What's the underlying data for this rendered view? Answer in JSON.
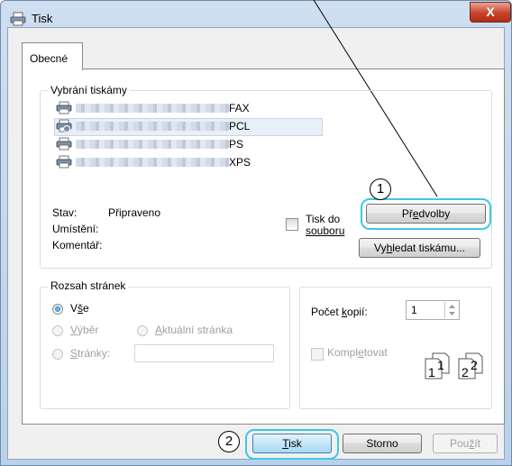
{
  "window": {
    "title": "Tisk",
    "close": "X"
  },
  "tabs": [
    {
      "label": "Obecné"
    }
  ],
  "printer_selection": {
    "title": "Vybrání tiskámy",
    "printers": [
      {
        "suffix": "FAX"
      },
      {
        "suffix": "PCL",
        "selected": true
      },
      {
        "suffix": "PS"
      },
      {
        "suffix": "XPS"
      }
    ],
    "status_label": "Stav:",
    "status_value": "Připraveno",
    "location_label": "Umístění:",
    "comment_label": "Komentář:",
    "print_to_file_line1": "Tisk do",
    "print_to_file_line2": "souboru",
    "preferences_button": {
      "pre": "Př",
      "accel": "e",
      "post": "dvolby"
    },
    "find_printer_button": {
      "pre": "Vy",
      "accel": "h",
      "post": "ledat tiskámu..."
    }
  },
  "page_range": {
    "title": "Rozsah stránek",
    "all": {
      "pre": "V",
      "accel": "š",
      "post": "e"
    },
    "selection": {
      "accel": "V",
      "post": "ýběr"
    },
    "current_page": {
      "accel": "A",
      "post": "ktuální stránka"
    },
    "pages": {
      "accel": "S",
      "post": "tránky:"
    }
  },
  "copies": {
    "label_pre": "Počet ",
    "label_accel": "k",
    "label_post": "opií:",
    "value": "1",
    "collate_pre": "Kompl",
    "collate_accel": "e",
    "collate_post": "tovat",
    "collate_icon_labels": [
      "1",
      "1",
      "2",
      "2"
    ]
  },
  "buttons": {
    "print": {
      "accel": "T",
      "post": "isk"
    },
    "cancel": "Storno",
    "apply": {
      "pre": "Pou",
      "accel": "ž",
      "post": "ít"
    }
  },
  "callouts": [
    "1",
    "2"
  ],
  "colors": {
    "highlight": "#3fc7e6",
    "title_bar": "#cfdff0"
  }
}
